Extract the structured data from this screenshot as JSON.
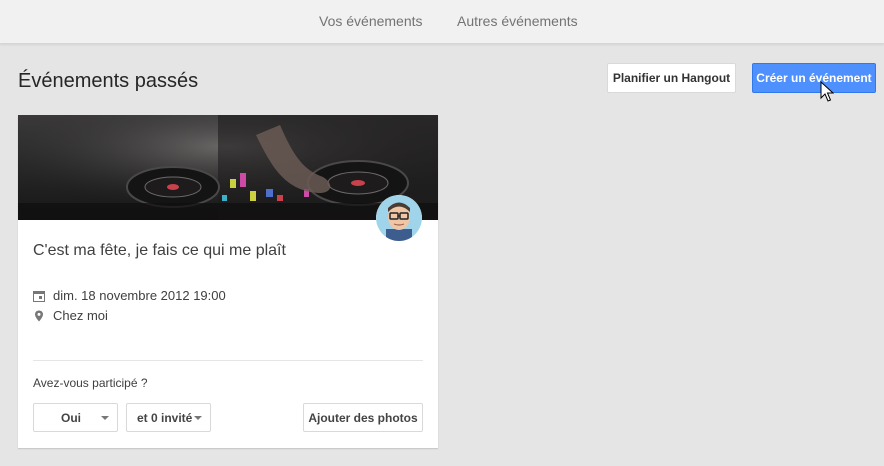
{
  "topnav": {
    "tabs": [
      {
        "label": "Vos événements"
      },
      {
        "label": "Autres événements"
      }
    ]
  },
  "header": {
    "title": "Événements passés",
    "hangout_button": "Planifier un Hangout",
    "create_button": "Créer un événement"
  },
  "event": {
    "title": "C'est ma fête, je fais ce qui me plaît",
    "date": "dim. 18 novembre 2012 19:00",
    "location": "Chez moi",
    "question": "Avez-vous participé ?",
    "rsvp_value": "Oui",
    "guests_value": "et 0 invité",
    "add_photos": "Ajouter des photos"
  },
  "colors": {
    "accent": "#4d90fe",
    "background": "#e5e5e5"
  },
  "icons": [
    "calendar-icon",
    "location-pin-icon",
    "chevron-down-icon",
    "mouse-cursor-icon"
  ]
}
